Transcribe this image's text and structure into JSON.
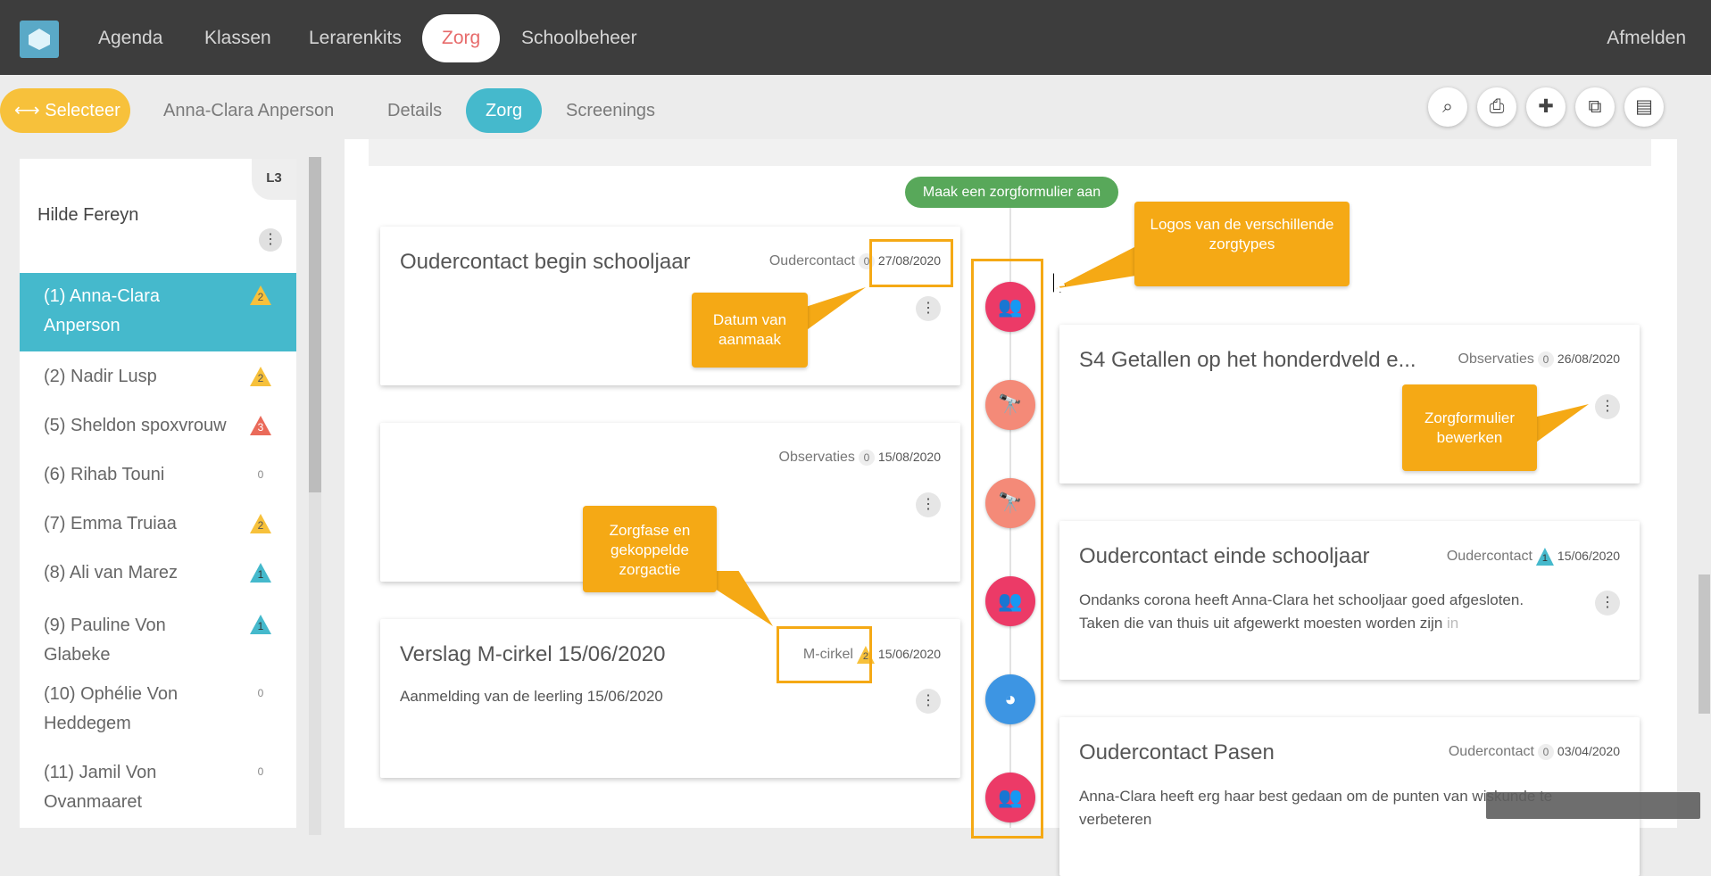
{
  "topnav": {
    "items": [
      "Agenda",
      "Klassen",
      "Lerarenkits",
      "Zorg",
      "Schoolbeheer"
    ],
    "active": "Zorg",
    "logout": "Afmelden"
  },
  "subnav": {
    "select_label": "Selecteer",
    "student_name": "Anna-Clara Anperson",
    "tabs": [
      "Details",
      "Zorg",
      "Screenings"
    ],
    "active_tab": "Zorg",
    "tools": [
      "search-icon",
      "print-icon",
      "file-plus-icon",
      "copy-plus-icon",
      "clipboard-icon"
    ]
  },
  "sidebar": {
    "teacher": "Hilde Fereyn",
    "level": "L3",
    "students": [
      {
        "label": "(1) Anna-Clara Anperson",
        "badge": "2",
        "color": "yellow",
        "selected": true
      },
      {
        "label": "(2) Nadir Lusp",
        "badge": "2",
        "color": "yellow"
      },
      {
        "label": "(5) Sheldon spoxvrouw",
        "badge": "3",
        "color": "red"
      },
      {
        "label": "(6) Rihab Touni",
        "badge": "0",
        "color": "none"
      },
      {
        "label": "(7) Emma Truiaa",
        "badge": "2",
        "color": "yellow"
      },
      {
        "label": "(8) Ali van Marez",
        "badge": "1",
        "color": "teal"
      },
      {
        "label": "(9) Pauline Von Glabeke",
        "badge": "1",
        "color": "teal"
      },
      {
        "label": "(10) Ophélie Von Heddegem",
        "badge": "0",
        "color": "none"
      },
      {
        "label": "(11) Jamil Von Ovanmaaret",
        "badge": "0",
        "color": "none"
      }
    ]
  },
  "timeline": {
    "create_button": "Maak een zorgformulier aan",
    "cards": [
      {
        "title": "Oudercontact begin schooljaar",
        "type": "Oudercontact",
        "phase": "0",
        "date": "27/08/2020",
        "body": ""
      },
      {
        "title": "S4 Getallen op het honderdveld e...",
        "type": "Observaties",
        "phase": "0",
        "date": "26/08/2020",
        "body": ""
      },
      {
        "title": "",
        "type": "Observaties",
        "phase": "0",
        "date": "15/08/2020",
        "body": ""
      },
      {
        "title": "Oudercontact einde schooljaar",
        "type": "Oudercontact",
        "phase": "1",
        "date": "15/06/2020",
        "body_line1": "Ondanks corona heeft Anna-Clara het schooljaar goed afgesloten.",
        "body_line2": "Taken die van thuis uit afgewerkt moesten worden zijn",
        "body_fade": " in"
      },
      {
        "title": "Verslag M-cirkel 15/06/2020",
        "type": "M-cirkel",
        "phase": "2",
        "date": "15/06/2020",
        "body": "Aanmelding van de leerling 15/06/2020"
      },
      {
        "title": "Oudercontact Pasen",
        "type": "Oudercontact",
        "phase": "0",
        "date": "03/04/2020",
        "body_line1": "Anna-Clara heeft erg haar best gedaan om de punten van wiskunde te",
        "body_line2": "verbeteren"
      }
    ],
    "nodes": [
      "parents-icon",
      "telescope-icon",
      "telescope-icon",
      "parents-icon",
      "pie-chart-icon",
      "parents-icon"
    ]
  },
  "annotations": {
    "logos": "Logos van de verschillende zorgtypes",
    "date": "Datum van aanmaak",
    "phase": "Zorgfase en gekoppelde zorgactie",
    "edit": "Zorgformulier bewerken"
  },
  "colors": {
    "accent_teal": "#45b9cc",
    "select_yellow": "#f7c13b",
    "callout_orange": "#f5a915",
    "active_nav_red": "#e76b6b",
    "create_green": "#58a85a"
  }
}
